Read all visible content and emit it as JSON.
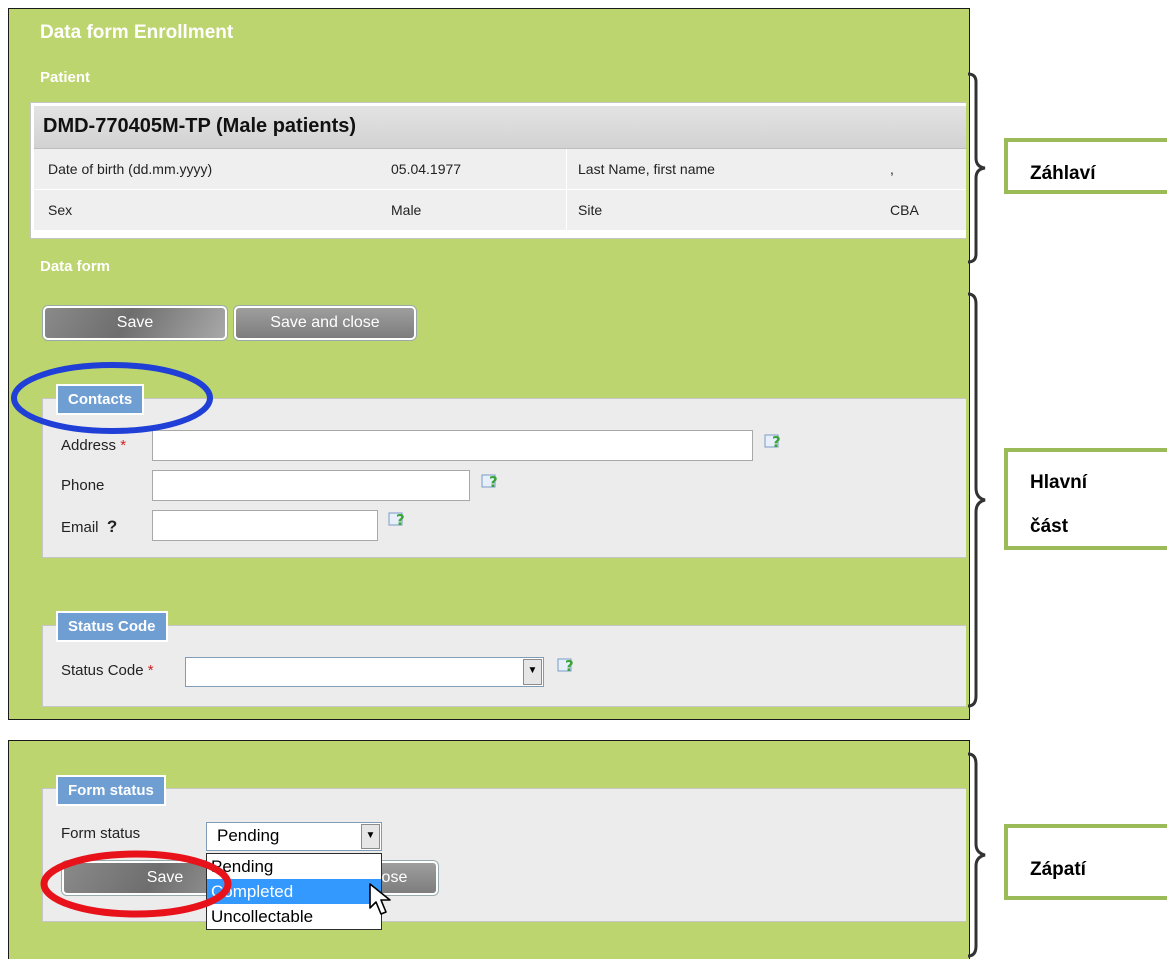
{
  "form": {
    "title": "Data form Enrollment",
    "patient_heading": "Patient",
    "patient_id": "DMD-770405M-TP (Male patients)",
    "rows": [
      {
        "label1": "Date of birth (dd.mm.yyyy)",
        "value1": "05.04.1977",
        "label2": "Last Name, first name",
        "value2": ","
      },
      {
        "label1": "Sex",
        "value1": "Male",
        "label2": "Site",
        "value2": "CBA"
      }
    ],
    "data_form_heading": "Data form",
    "save_label": "Save",
    "save_close_label": "Save and close",
    "contacts": {
      "legend": "Contacts",
      "address_label": "Address",
      "address_required": "*",
      "phone_label": "Phone",
      "email_label": "Email",
      "email_marker": "?",
      "address_value": "",
      "phone_value": "",
      "email_value": ""
    },
    "status_code": {
      "legend": "Status Code",
      "label": "Status Code",
      "required": "*",
      "value": ""
    }
  },
  "footer": {
    "legend": "Form status",
    "label": "Form status",
    "selected": "Pending",
    "options": [
      "Pending",
      "Completed",
      "Uncollectable"
    ],
    "highlighted": "Completed",
    "save_label": "Save",
    "save_close_partial": "lose"
  },
  "annotations": {
    "header": "Záhlaví",
    "main_line1": "Hlavní",
    "main_line2": "část",
    "footer": "Zápatí"
  },
  "colors": {
    "panel_green": "#bdd56e",
    "legend_blue": "#6f9ed2",
    "highlight_blue_oval": "#1f3fd6",
    "highlight_red_oval": "#e8121a",
    "annotation_border": "#9bbb59",
    "selected_option": "#3399ff"
  },
  "icons": [
    "help-icon",
    "chevron-down-icon",
    "mouse-cursor-icon",
    "bracket-icon"
  ]
}
